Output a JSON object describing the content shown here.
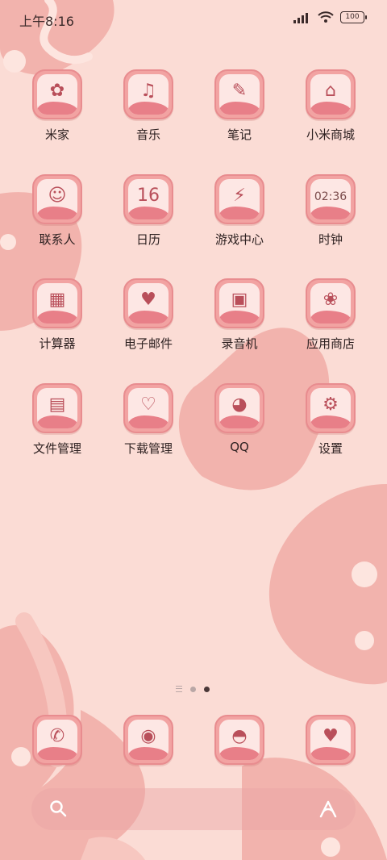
{
  "status": {
    "time": "上午8:16",
    "battery": "100"
  },
  "apps": [
    {
      "label": "米家",
      "icon": "flower-bunny-icon",
      "glyph": "✿"
    },
    {
      "label": "音乐",
      "icon": "bunny-music-icon",
      "glyph": "♫"
    },
    {
      "label": "笔记",
      "icon": "notebook-icon",
      "glyph": "✎"
    },
    {
      "label": "小米商城",
      "icon": "shopping-bag-icon",
      "glyph": "⌂"
    },
    {
      "label": "联系人",
      "icon": "bunny-contact-icon",
      "glyph": "☺"
    },
    {
      "label": "日历",
      "icon": "calendar-icon",
      "glyph": "16"
    },
    {
      "label": "游戏中心",
      "icon": "battery-game-icon",
      "glyph": "⚡"
    },
    {
      "label": "时钟",
      "icon": "clock-icon",
      "glyph": "02:36"
    },
    {
      "label": "计算器",
      "icon": "calculator-icon",
      "glyph": "▦"
    },
    {
      "label": "电子邮件",
      "icon": "heart-mail-icon",
      "glyph": "♥"
    },
    {
      "label": "录音机",
      "icon": "radio-recorder-icon",
      "glyph": "▣"
    },
    {
      "label": "应用商店",
      "icon": "strawberry-store-icon",
      "glyph": "❀"
    },
    {
      "label": "文件管理",
      "icon": "folder-icon",
      "glyph": "▤"
    },
    {
      "label": "下载管理",
      "icon": "heart-download-icon",
      "glyph": "♡"
    },
    {
      "label": "QQ",
      "icon": "qq-penguin-icon",
      "glyph": "◕"
    },
    {
      "label": "设置",
      "icon": "gear-bow-icon",
      "glyph": "⚙"
    }
  ],
  "dock": [
    {
      "icon": "phone-bunny-icon",
      "glyph": "✆"
    },
    {
      "icon": "strawberry-message-icon",
      "glyph": "◉"
    },
    {
      "icon": "pokeball-camera-icon",
      "glyph": "◓"
    },
    {
      "icon": "heart-camera-icon",
      "glyph": "♥"
    }
  ],
  "colors": {
    "background": "#fbdcd5",
    "tile": "#f2a3a2",
    "tile_wave": "#e87f88",
    "blob": "#f2b3ad"
  }
}
